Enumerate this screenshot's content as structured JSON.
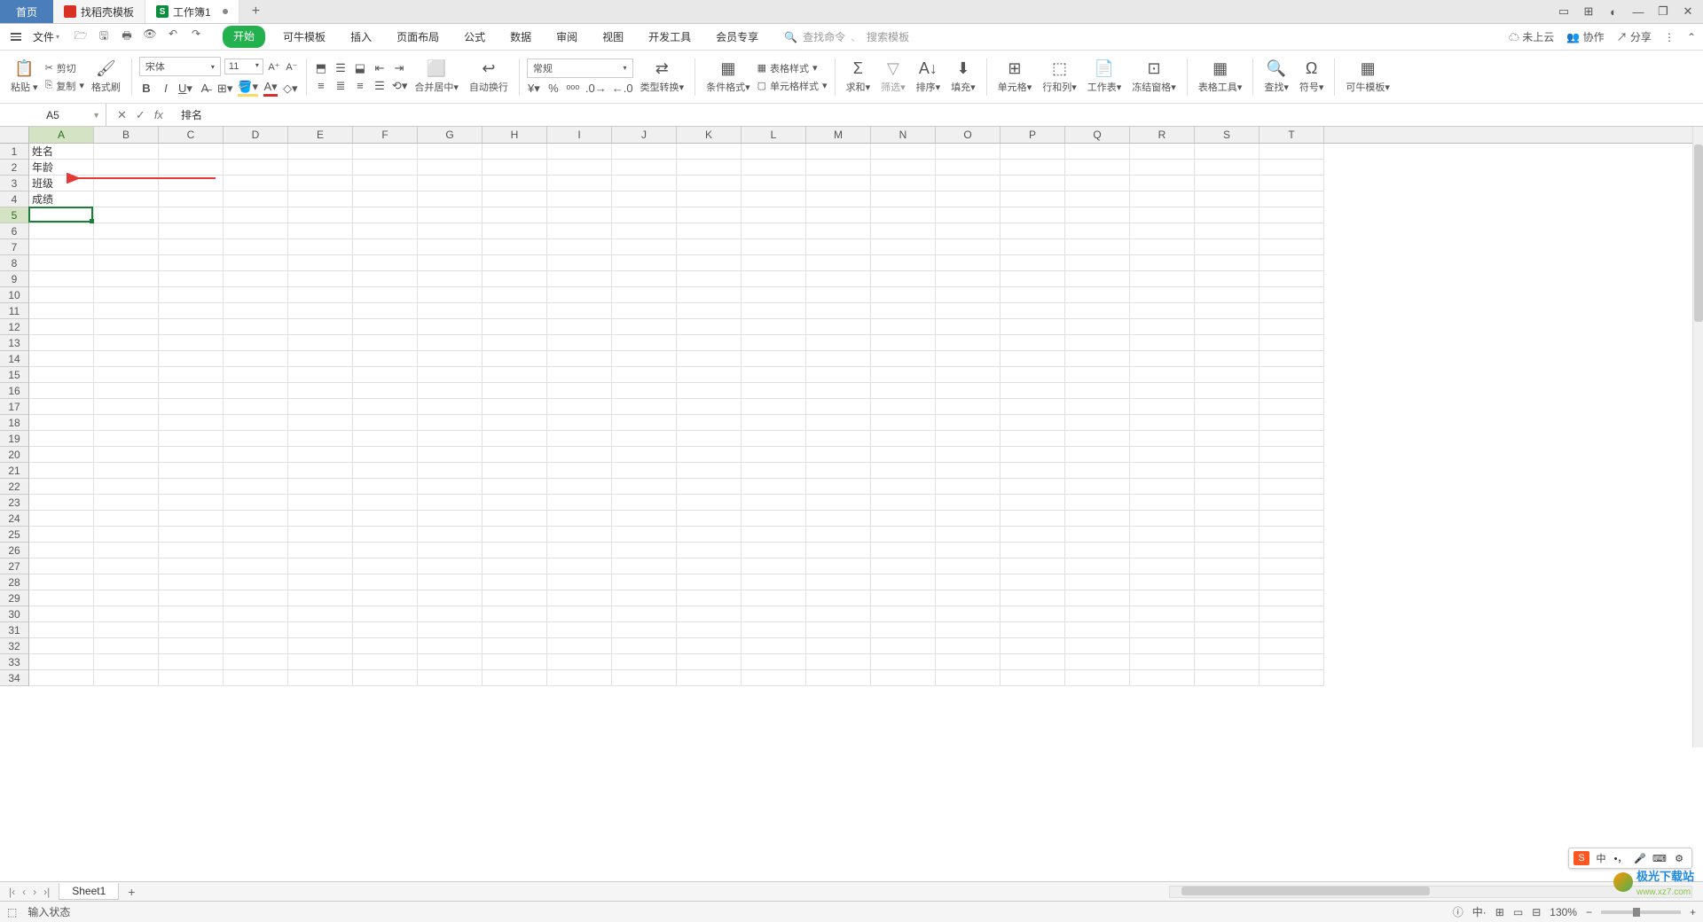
{
  "tabs": {
    "home": "首页",
    "template": "找稻壳模板",
    "workbook": "工作簿1"
  },
  "menu": {
    "file": "文件",
    "tabs": [
      "开始",
      "可牛模板",
      "插入",
      "页面布局",
      "公式",
      "数据",
      "审阅",
      "视图",
      "开发工具",
      "会员专享"
    ],
    "search_cmd_placeholder": "查找命令",
    "search_tpl_placeholder": "搜索模板",
    "cloud": "未上云",
    "coop": "协作",
    "share": "分享"
  },
  "ribbon": {
    "paste": "粘贴",
    "cut": "剪切",
    "copy": "复制",
    "format_painter": "格式刷",
    "font_name": "宋体",
    "font_size": "11",
    "merge_center": "合并居中",
    "wrap": "自动换行",
    "number_format": "常规",
    "type_convert": "类型转换",
    "cond_format": "条件格式",
    "table_style": "表格样式",
    "cell_style": "单元格样式",
    "sum": "求和",
    "filter": "筛选",
    "sort": "排序",
    "fill": "填充",
    "cell": "单元格",
    "rowcol": "行和列",
    "worksheet": "工作表",
    "freeze": "冻结窗格",
    "table_tools": "表格工具",
    "find": "查找",
    "symbol": "符号",
    "kn_template": "可牛模板"
  },
  "namebox": "A5",
  "formula": "排名",
  "columns": [
    "A",
    "B",
    "C",
    "D",
    "E",
    "F",
    "G",
    "H",
    "I",
    "J",
    "K",
    "L",
    "M",
    "N",
    "O",
    "P",
    "Q",
    "R",
    "S",
    "T"
  ],
  "row_count": 34,
  "cell_data": {
    "A1": "姓名",
    "A2": "年龄",
    "A3": "班级",
    "A4": "成绩",
    "A5": "排名"
  },
  "active_cell": {
    "row": 5,
    "col": 1
  },
  "sheet": {
    "name": "Sheet1"
  },
  "status": {
    "mode": "输入状态",
    "zoom": "130%"
  },
  "ime": {
    "lang": "中",
    "punc": "•，",
    "full": "⬚"
  },
  "watermark": {
    "name": "极光下载站",
    "url": "www.xz7.com"
  }
}
